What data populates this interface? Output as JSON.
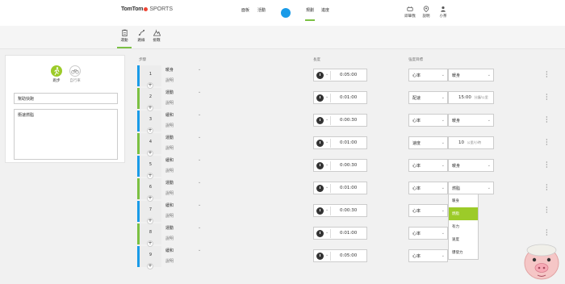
{
  "brand": {
    "name": "TomTom",
    "product": "SPORTS"
  },
  "nav": {
    "items": [
      "面板",
      "活動",
      "規劃",
      "進度"
    ],
    "active": "規劃"
  },
  "right_nav": [
    "即筆我",
    "說明",
    "小茶"
  ],
  "subtabs": {
    "items": [
      "運動",
      "路線",
      "挑戰"
    ],
    "active": "運動"
  },
  "left_panel": {
    "sports": [
      "跑步",
      "自行車"
    ],
    "name_value": "幫助快跑",
    "desc_value": "衝速燃脂"
  },
  "table": {
    "headers": {
      "step": "步驟",
      "duration": "長度",
      "target": "強度目標"
    },
    "rows": [
      {
        "num": "1",
        "type": "暖身",
        "desc": "說明",
        "duration": "0:05:00",
        "target_type": "心率",
        "target_value": "暖身",
        "target_unit": "",
        "color": "blue"
      },
      {
        "num": "2",
        "type": "運動",
        "desc": "說明",
        "duration": "0:01:00",
        "target_type": "配速",
        "target_value": "15:00",
        "target_unit": "分鐘/公里",
        "color": "green"
      },
      {
        "num": "3",
        "type": "緩和",
        "desc": "說明",
        "duration": "0:00:30",
        "target_type": "心率",
        "target_value": "暖身",
        "target_unit": "",
        "color": "blue"
      },
      {
        "num": "4",
        "type": "運動",
        "desc": "說明",
        "duration": "0:01:00",
        "target_type": "速度",
        "target_value": "10",
        "target_unit": "公里/小時",
        "color": "green"
      },
      {
        "num": "5",
        "type": "緩和",
        "desc": "說明",
        "duration": "0:00:30",
        "target_type": "心率",
        "target_value": "暖身",
        "target_unit": "",
        "color": "blue"
      },
      {
        "num": "6",
        "type": "運動",
        "desc": "說明",
        "duration": "0:01:00",
        "target_type": "心率",
        "target_value": "燃脂",
        "target_unit": "",
        "color": "green"
      },
      {
        "num": "7",
        "type": "緩和",
        "desc": "說明",
        "duration": "0:00:30",
        "target_type": "心率",
        "target_value": "",
        "target_unit": "",
        "color": "blue"
      },
      {
        "num": "8",
        "type": "運動",
        "desc": "說明",
        "duration": "0:01:00",
        "target_type": "心率",
        "target_value": "",
        "target_unit": "",
        "color": "green"
      },
      {
        "num": "9",
        "type": "緩和",
        "desc": "說明",
        "duration": "0:05:00",
        "target_type": "心率",
        "target_value": "",
        "target_unit": "",
        "color": "blue"
      }
    ]
  },
  "dropdown": {
    "options": [
      "暖身",
      "燃脂",
      "有力",
      "速度",
      "爆發力"
    ],
    "selected": "燃脂"
  },
  "colors": {
    "accent_green": "#7bc043",
    "blue": "#1a9be8",
    "select_green": "#9ccb29"
  }
}
